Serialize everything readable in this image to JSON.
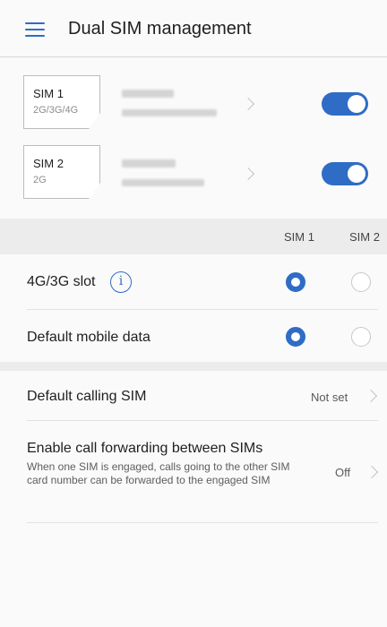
{
  "header": {
    "title": "Dual SIM management"
  },
  "sims": [
    {
      "name": "SIM 1",
      "tech": "2G/3G/4G",
      "enabled": true
    },
    {
      "name": "SIM 2",
      "tech": "2G",
      "enabled": true
    }
  ],
  "columns": {
    "sim1": "SIM 1",
    "sim2": "SIM 2"
  },
  "slots": [
    {
      "label": "4G/3G slot",
      "selected": "sim1"
    },
    {
      "label": "Default mobile data",
      "selected": "sim1"
    }
  ],
  "calling": {
    "label": "Default calling SIM",
    "value": "Not set"
  },
  "forwarding": {
    "label": "Enable call forwarding between SIMs",
    "description": "When one SIM is engaged, calls going to the other SIM card number can be forwarded to the engaged SIM",
    "value": "Off"
  },
  "colors": {
    "accent": "#2f6cc5"
  },
  "icons": {
    "menu": "hamburger-menu-icon",
    "info": "info-icon",
    "chevron": "chevron-right-icon"
  }
}
